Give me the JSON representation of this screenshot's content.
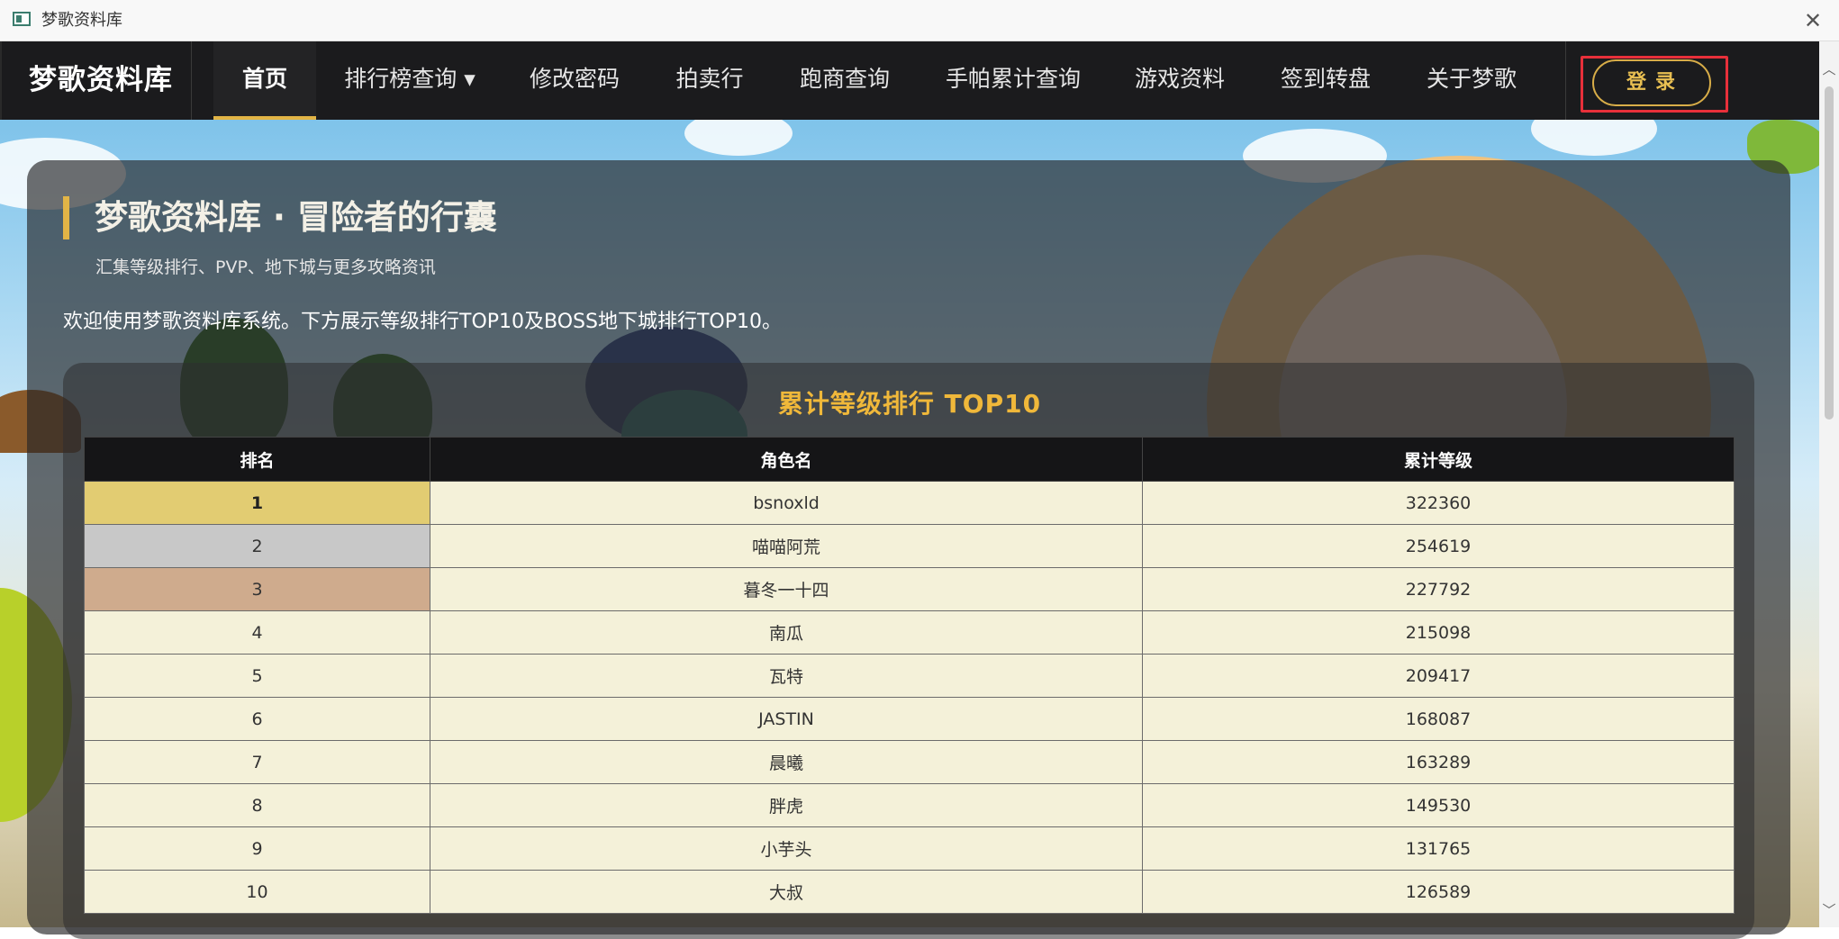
{
  "window": {
    "title": "梦歌资料库",
    "close_glyph": "✕"
  },
  "navbar": {
    "brand": "梦歌资料库",
    "items": [
      {
        "label": "首页",
        "active": true
      },
      {
        "label": "排行榜查询 ▾",
        "active": false
      },
      {
        "label": "修改密码",
        "active": false
      },
      {
        "label": "拍卖行",
        "active": false
      },
      {
        "label": "跑商查询",
        "active": false
      },
      {
        "label": "手帕累计查询",
        "active": false
      },
      {
        "label": "游戏资料",
        "active": false
      },
      {
        "label": "签到转盘",
        "active": false
      },
      {
        "label": "关于梦歌",
        "active": false
      }
    ],
    "login_label": "登录"
  },
  "hero": {
    "title": "梦歌资料库 · 冒险者的行囊",
    "subtitle": "汇集等级排行、PVP、地下城与更多攻略资讯",
    "intro": "欢迎使用梦歌资料库系统。下方展示等级排行TOP10及BOSS地下城排行TOP10。"
  },
  "ranking": {
    "title": "累计等级排行 TOP10",
    "columns": [
      "排名",
      "角色名",
      "累计等级"
    ],
    "rows": [
      {
        "rank": "1",
        "name": "bsnoxld",
        "level": "322360"
      },
      {
        "rank": "2",
        "name": "喵喵阿荒",
        "level": "254619"
      },
      {
        "rank": "3",
        "name": "暮冬一十四",
        "level": "227792"
      },
      {
        "rank": "4",
        "name": "南瓜",
        "level": "215098"
      },
      {
        "rank": "5",
        "name": "瓦特",
        "level": "209417"
      },
      {
        "rank": "6",
        "name": "JASTIN",
        "level": "168087"
      },
      {
        "rank": "7",
        "name": "晨曦",
        "level": "163289"
      },
      {
        "rank": "8",
        "name": "胖虎",
        "level": "149530"
      },
      {
        "rank": "9",
        "name": "小芋头",
        "level": "131765"
      },
      {
        "rank": "10",
        "name": "大叔",
        "level": "126589"
      }
    ]
  },
  "colors": {
    "accent": "#e2b446",
    "navbar_bg": "#1b1b1d",
    "login_highlight": "#e8303a",
    "rank_title": "#f0b83a",
    "gold": "#e2cc72",
    "silver": "#c8c8c8",
    "bronze": "#cfab8d",
    "row_bg": "#f4f1d9"
  },
  "scrollbar": {
    "up_glyph": "︿",
    "down_glyph": "﹀"
  }
}
